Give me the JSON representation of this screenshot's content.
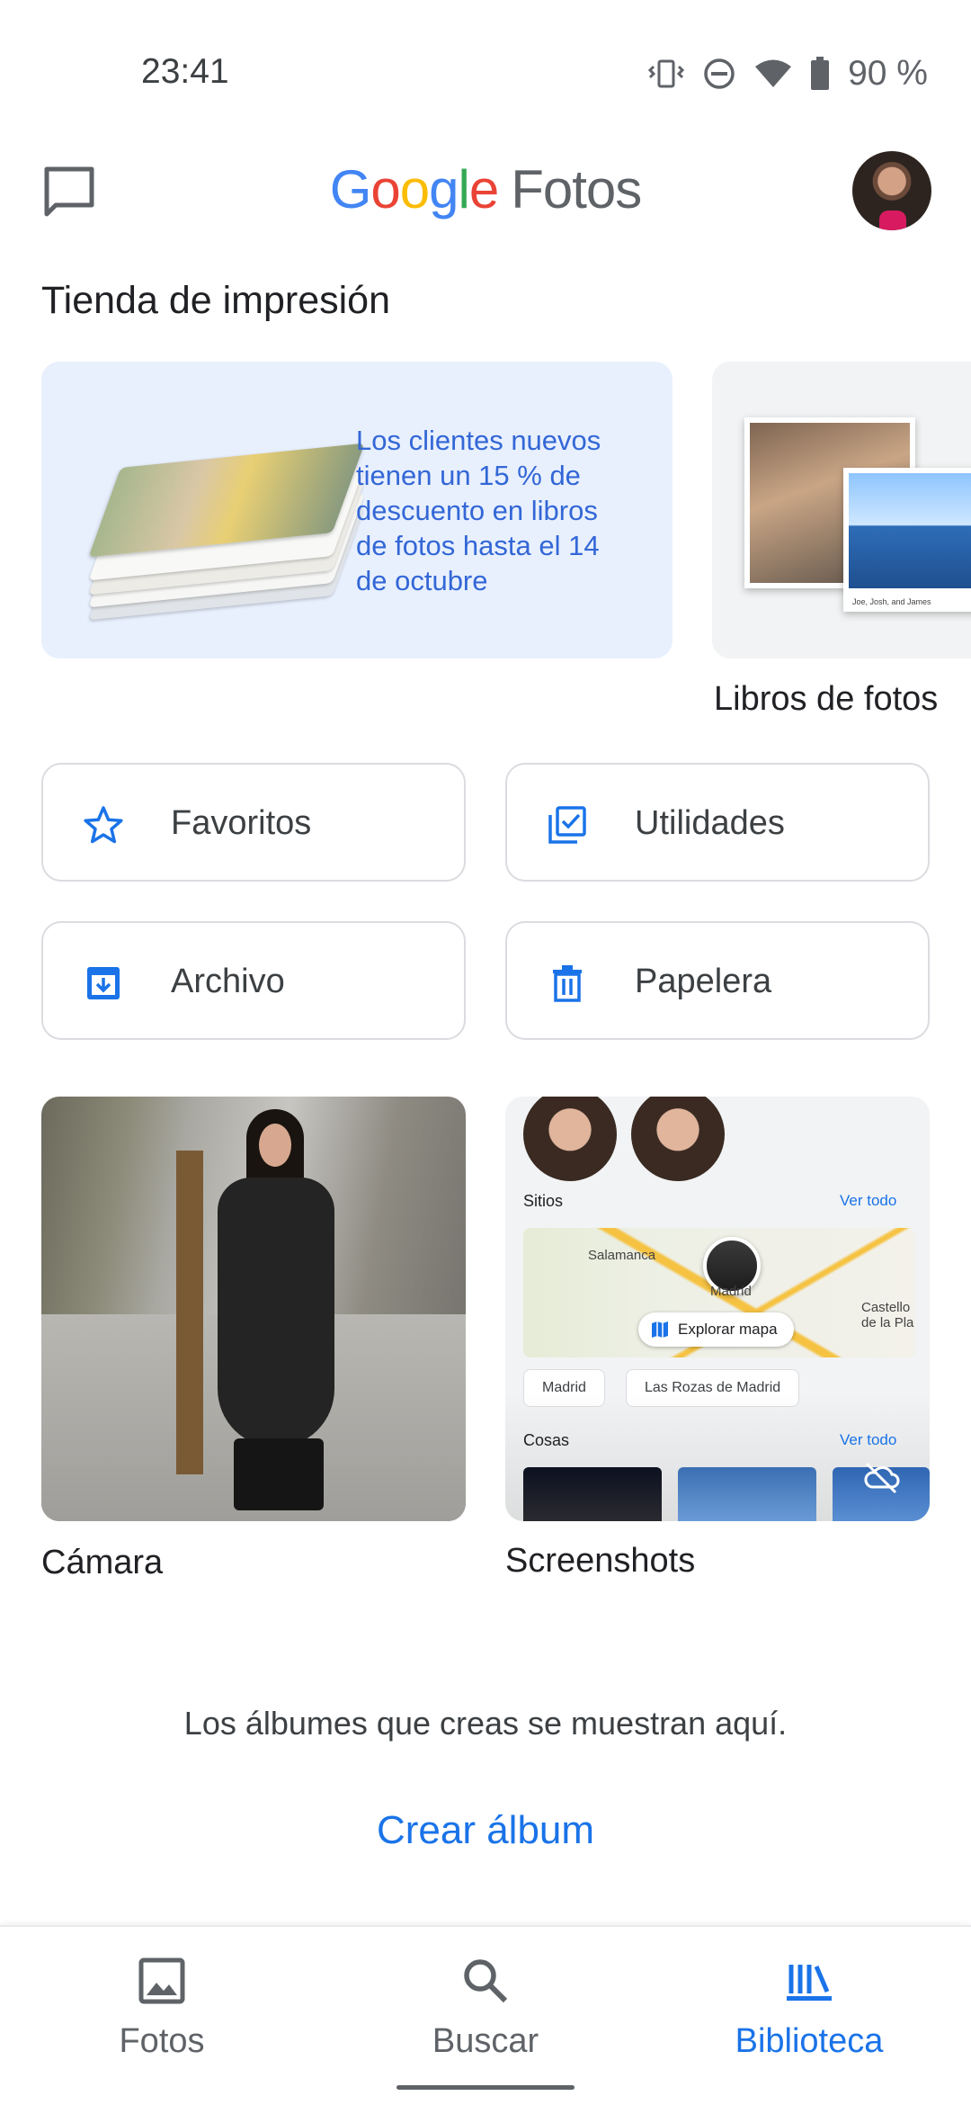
{
  "status_bar": {
    "time": "23:41",
    "battery": "90 %"
  },
  "app_bar": {
    "logo_g1": "G",
    "logo_o1": "o",
    "logo_o2": "o",
    "logo_g2": "g",
    "logo_l": "l",
    "logo_e": "e",
    "logo_product": "Fotos"
  },
  "print_store": {
    "title": "Tienda de impresión",
    "promo_text": "Los clientes nuevos tienen un 15 % de descuento en libros de fotos hasta el 14 de octubre",
    "side_card_label": "Libros de fotos",
    "side_card_caption": "Joe, Josh, and James"
  },
  "utilities": {
    "favorites": "Favoritos",
    "utilities": "Utilidades",
    "archive": "Archivo",
    "trash": "Papelera"
  },
  "albums": [
    {
      "label": "Cámara"
    },
    {
      "label": "Screenshots"
    }
  ],
  "screenshot_preview": {
    "places_label": "Sitios",
    "see_all": "Ver todo",
    "city_1": "Salamanca",
    "city_2": "Madrid",
    "city_3": "Castello de la Pla",
    "explore_map": "Explorar mapa",
    "chip_1": "Madrid",
    "chip_2": "Las Rozas de Madrid",
    "things_label": "Cosas",
    "things_see_all": "Ver todo"
  },
  "empty_state": {
    "message": "Los álbumes que creas se muestran aquí.",
    "create_album": "Crear álbum"
  },
  "bottom_nav": [
    {
      "label": "Fotos",
      "icon": "photo-icon",
      "active": false
    },
    {
      "label": "Buscar",
      "icon": "search-icon",
      "active": false
    },
    {
      "label": "Biblioteca",
      "icon": "library-icon",
      "active": true
    }
  ],
  "colors": {
    "accent": "#1a73e8",
    "promo_bg": "#e8f0fe",
    "promo_text": "#3367d6"
  }
}
